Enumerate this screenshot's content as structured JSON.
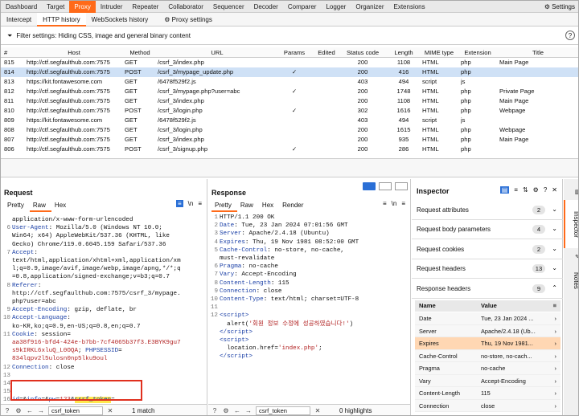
{
  "top_tabs": [
    "Dashboard",
    "Target",
    "Proxy",
    "Intruder",
    "Repeater",
    "Collaborator",
    "Sequencer",
    "Decoder",
    "Comparer",
    "Logger",
    "Organizer",
    "Extensions"
  ],
  "top_active": 2,
  "settings_label": "Settings",
  "sub_tabs": [
    "Intercept",
    "HTTP history",
    "WebSockets history"
  ],
  "sub_active": 1,
  "proxy_settings_label": "Proxy settings",
  "filter_text": "Filter settings: Hiding CSS, image and general binary content",
  "table": {
    "columns": [
      "#",
      "Host",
      "Method",
      "URL",
      "Params",
      "Edited",
      "Status code",
      "Length",
      "MIME type",
      "Extension",
      "Title"
    ],
    "rows": [
      [
        "815",
        "http://ctf.segfaulthub.com:7575",
        "GET",
        "/csrf_3/index.php",
        "",
        "",
        "200",
        "1108",
        "HTML",
        "php",
        "Main Page"
      ],
      [
        "814",
        "http://ctf.segfaulthub.com:7575",
        "POST",
        "/csrf_3/mypage_update.php",
        "✓",
        "",
        "200",
        "416",
        "HTML",
        "php",
        ""
      ],
      [
        "813",
        "https://kit.fontawesome.com",
        "GET",
        "/6478f529f2.js",
        "",
        "",
        "403",
        "494",
        "script",
        "js",
        ""
      ],
      [
        "812",
        "http://ctf.segfaulthub.com:7575",
        "GET",
        "/csrf_3/mypage.php?user=abc",
        "✓",
        "",
        "200",
        "1748",
        "HTML",
        "php",
        "Private Page"
      ],
      [
        "811",
        "http://ctf.segfaulthub.com:7575",
        "GET",
        "/csrf_3/index.php",
        "",
        "",
        "200",
        "1108",
        "HTML",
        "php",
        "Main Page"
      ],
      [
        "810",
        "http://ctf.segfaulthub.com:7575",
        "POST",
        "/csrf_3/login.php",
        "✓",
        "",
        "302",
        "1616",
        "HTML",
        "php",
        "Webpage"
      ],
      [
        "809",
        "https://kit.fontawesome.com",
        "GET",
        "/6478f529f2.js",
        "",
        "",
        "403",
        "494",
        "script",
        "js",
        ""
      ],
      [
        "808",
        "http://ctf.segfaulthub.com:7575",
        "GET",
        "/csrf_3/login.php",
        "",
        "",
        "200",
        "1615",
        "HTML",
        "php",
        "Webpage"
      ],
      [
        "807",
        "http://ctf.segfaulthub.com:7575",
        "GET",
        "/csrf_3/index.php",
        "",
        "",
        "200",
        "935",
        "HTML",
        "php",
        "Main Page"
      ],
      [
        "806",
        "http://ctf.segfaulthub.com:7575",
        "POST",
        "/csrf_3/signup.php",
        "✓",
        "",
        "200",
        "286",
        "HTML",
        "php",
        ""
      ]
    ],
    "selected": 1
  },
  "request": {
    "title": "Request",
    "tabs": [
      "Pretty",
      "Raw",
      "Hex"
    ],
    "active_tab": 1,
    "search_value": "csrf_token",
    "match_text": "1 match"
  },
  "response": {
    "title": "Response",
    "tabs": [
      "Pretty",
      "Raw",
      "Hex",
      "Render"
    ],
    "active_tab": 0,
    "search_value": "csrf_token",
    "match_text": "0 highlights"
  },
  "inspector": {
    "title": "Inspector",
    "sections": [
      {
        "label": "Request attributes",
        "count": "2"
      },
      {
        "label": "Request body parameters",
        "count": "4"
      },
      {
        "label": "Request cookies",
        "count": "2"
      },
      {
        "label": "Request headers",
        "count": "13"
      },
      {
        "label": "Response headers",
        "count": "9"
      }
    ],
    "col_name": "Name",
    "col_value": "Value",
    "headers": [
      [
        "Date",
        "Tue, 23 Jan 2024 ..."
      ],
      [
        "Server",
        "Apache/2.4.18 (Ub..."
      ],
      [
        "Expires",
        "Thu, 19 Nov 1981..."
      ],
      [
        "Cache-Control",
        "no-store, no-cach..."
      ],
      [
        "Pragma",
        "no-cache"
      ],
      [
        "Vary",
        "Accept-Encoding"
      ],
      [
        "Content-Length",
        "115"
      ],
      [
        "Connection",
        "close"
      ]
    ],
    "selected_header": 2
  },
  "side_tabs": [
    "Inspector",
    "Notes"
  ],
  "colors": {
    "accent": "#ff6a19",
    "selected_row": "#cfe1f6",
    "highlight": "#ffe84d",
    "keyword": "#1a3fa6"
  }
}
